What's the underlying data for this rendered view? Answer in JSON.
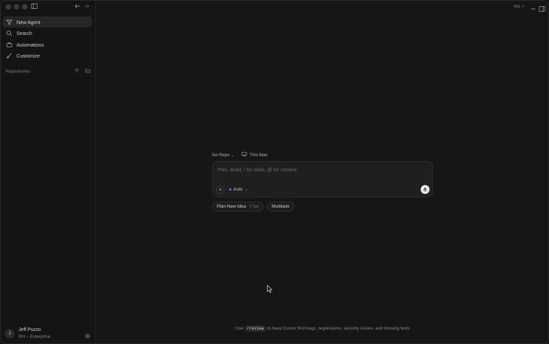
{
  "window": {
    "title_right_ide_label": "IDE ↗"
  },
  "sidebar": {
    "nav": [
      {
        "label": "New Agent",
        "icon": "new-agent-icon"
      },
      {
        "label": "Search",
        "icon": "search-icon"
      },
      {
        "label": "Automations",
        "icon": "briefcase-icon"
      },
      {
        "label": "Customize",
        "icon": "brush-icon"
      }
    ],
    "repositories_label": "Repositories",
    "user": {
      "initial": "J",
      "name": "Jeff Puzzo",
      "org": "RH – Enterprise"
    }
  },
  "composer": {
    "repo_select": "No Repo",
    "machine": "This Mac",
    "placeholder": "Plan, Build, / for skills, @ for context",
    "model": "Auto",
    "chips": [
      {
        "label": "Plan New Idea",
        "hint": "⇧Tab"
      },
      {
        "label": "Multitask",
        "hint": ""
      }
    ]
  },
  "tip": {
    "prefix": "Use",
    "code": "/review",
    "suffix": "to have Cursor find bugs, regressions, security issues, and missing tests"
  },
  "colors": {
    "background": "#161616",
    "sidebar": "#141414",
    "accent_dot": "#6c90ff"
  }
}
